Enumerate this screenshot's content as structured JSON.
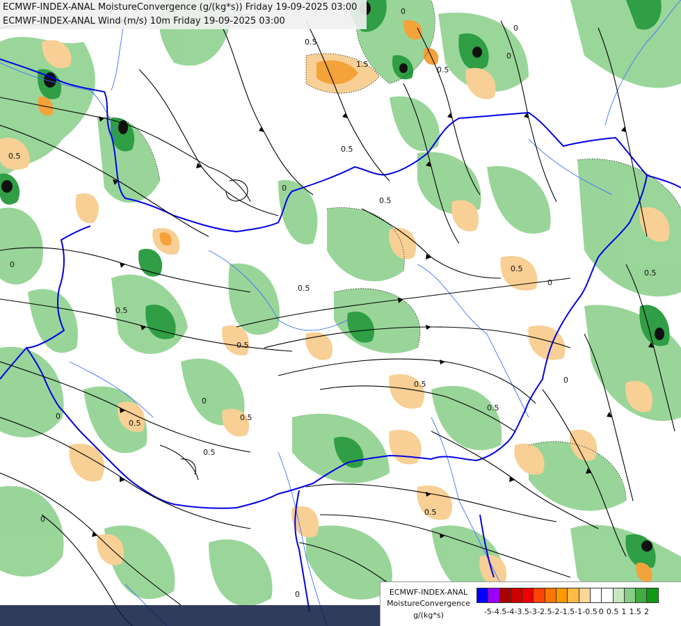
{
  "titles": {
    "line1": "ECMWF-INDEX-ANAL MoistureConvergence (g/(kg*s)) Friday 19-09-2025 03:00",
    "line2": "ECMWF-INDEX-ANAL Wind (m/s) 10m Friday 19-09-2025 03:00"
  },
  "legend": {
    "line1": "ECMWF-INDEX-ANAL",
    "line2": "MoistureConvergence",
    "unit": "g/(kg*s)",
    "ticks": [
      "-5",
      "-4.5",
      "-4",
      "-3.5",
      "-3",
      "-2.5",
      "-2",
      "-1.5",
      "-1",
      "-0.5",
      "0",
      "0.5",
      "1",
      "1.5",
      "2"
    ],
    "colors": [
      "#0000ff",
      "#9900ff",
      "#aa0000",
      "#cc0000",
      "#ee0000",
      "#ff4400",
      "#ff7700",
      "#ff9900",
      "#ffbb44",
      "#ffd699",
      "#ffffff",
      "#ffffff",
      "#c8e8c0",
      "#88cc88",
      "#44aa44",
      "#119911"
    ]
  },
  "contour_labels": [
    "0",
    "0.5",
    "-0.5",
    "-1.5",
    "1.5"
  ],
  "map_colors": {
    "background": "#ffffff",
    "convergence": "#7fc97f",
    "strong_convergence": "#2e9e3e",
    "divergence": "#f7c98a",
    "strong_divergence": "#f39a2a",
    "border": "#0000ee",
    "river": "#3366ff",
    "streamline": "#000000"
  }
}
